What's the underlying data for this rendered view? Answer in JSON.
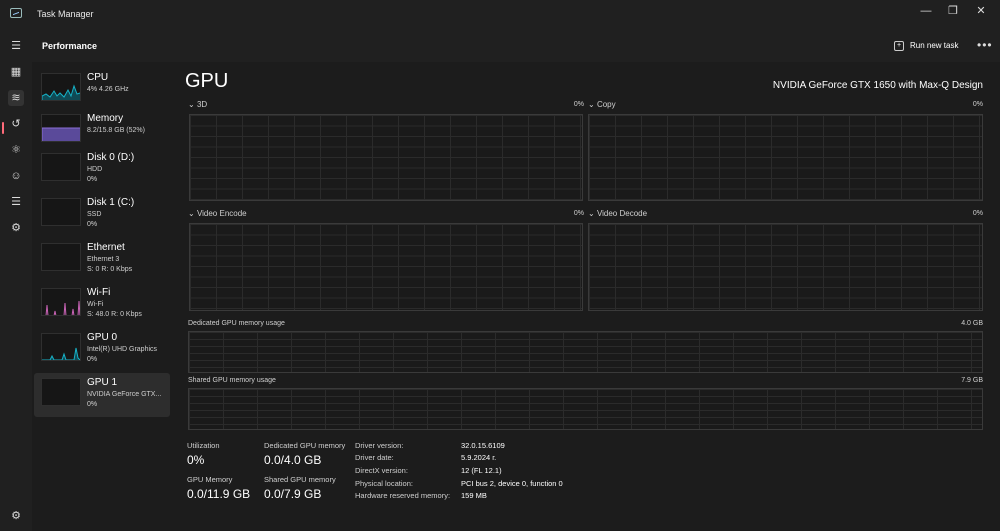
{
  "window": {
    "title": "Task Manager"
  },
  "header": {
    "title": "Performance",
    "run_task_label": "Run new task"
  },
  "devices": [
    {
      "name": "CPU",
      "line1": "4% 4.26 GHz",
      "line2": "",
      "color": "#17b3c8"
    },
    {
      "name": "Memory",
      "line1": "8.2/15.8 GB (52%)",
      "line2": "",
      "color": "#8a6fd6"
    },
    {
      "name": "Disk 0 (D:)",
      "line1": "HDD",
      "line2": "0%",
      "color": "#7ad468"
    },
    {
      "name": "Disk 1 (C:)",
      "line1": "SSD",
      "line2": "0%",
      "color": "#7ad468"
    },
    {
      "name": "Ethernet",
      "line1": "Ethernet 3",
      "line2": "S: 0 R: 0 Kbps",
      "color": "#c863b5"
    },
    {
      "name": "Wi-Fi",
      "line1": "Wi-Fi",
      "line2": "S: 48.0 R: 0 Kbps",
      "color": "#c863b5"
    },
    {
      "name": "GPU 0",
      "line1": "Intel(R) UHD Graphics",
      "line2": "0%",
      "color": "#17b3c8"
    },
    {
      "name": "GPU 1",
      "line1": "NVIDIA GeForce GTX...",
      "line2": "0%",
      "color": "#17b3c8"
    }
  ],
  "gpu": {
    "title": "GPU",
    "model": "NVIDIA GeForce GTX 1650 with Max-Q Design",
    "graphs": [
      {
        "label": "3D",
        "value": "0%"
      },
      {
        "label": "Copy",
        "value": "0%"
      },
      {
        "label": "Video Encode",
        "value": "0%"
      },
      {
        "label": "Video Decode",
        "value": "0%"
      }
    ],
    "dedicated_label": "Dedicated GPU memory usage",
    "dedicated_max": "4.0 GB",
    "shared_label": "Shared GPU memory usage",
    "shared_max": "7.9 GB"
  },
  "stats": {
    "utilization_label": "Utilization",
    "utilization": "0%",
    "dedicated_label": "Dedicated GPU memory",
    "dedicated": "0.0/4.0 GB",
    "gpu_memory_label": "GPU Memory",
    "gpu_memory": "0.0/11.9 GB",
    "shared_label": "Shared GPU memory",
    "shared": "0.0/7.9 GB"
  },
  "details": [
    {
      "key": "Driver version:",
      "value": "32.0.15.6109"
    },
    {
      "key": "Driver date:",
      "value": "5.9.2024 г."
    },
    {
      "key": "DirectX version:",
      "value": "12 (FL 12.1)"
    },
    {
      "key": "Physical location:",
      "value": "PCI bus 2, device 0, function 0"
    },
    {
      "key": "Hardware reserved memory:",
      "value": "159 MB"
    }
  ]
}
